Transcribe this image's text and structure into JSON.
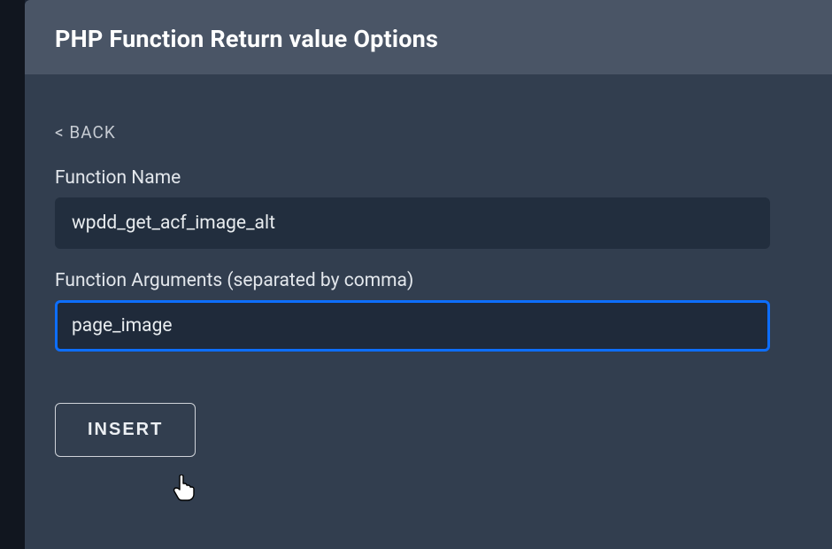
{
  "header": {
    "title": "PHP Function Return value Options"
  },
  "nav": {
    "back_label": "< BACK"
  },
  "fields": {
    "function_name": {
      "label": "Function Name",
      "value": "wpdd_get_acf_image_alt"
    },
    "function_args": {
      "label": "Function Arguments (separated by comma)",
      "value": "page_image"
    }
  },
  "actions": {
    "insert_label": "INSERT"
  }
}
